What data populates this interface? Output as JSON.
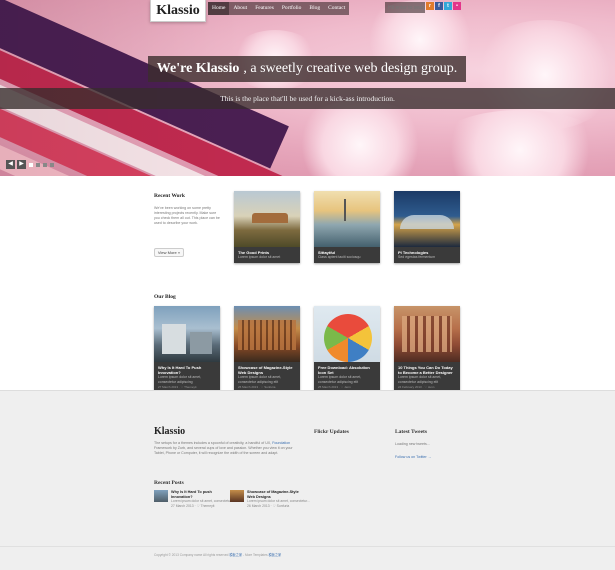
{
  "logo": "Klassio",
  "nav": [
    "Home",
    "About",
    "Features",
    "Portfolio",
    "Blog",
    "Contact"
  ],
  "search": {
    "placeholder": "Hit enter to search"
  },
  "social": [
    "rss-icon",
    "facebook-icon",
    "twitter-icon",
    "flickr-icon"
  ],
  "hero": {
    "headline_bold": "We're Klassio",
    "headline_rest": ", a sweetly creative web design group.",
    "subline": "This is the place that'll be used for a kick-ass introduction."
  },
  "recent_work": {
    "title": "Recent Work",
    "intro": "We've been working on some pretty interesting projects recently. Make sure you check them all out. This place can be used to describe your work.",
    "more_button": "View More »",
    "items": [
      {
        "title": "The Good Prints",
        "desc": "Lorem ipsum dolor sit amet"
      },
      {
        "title": "Sittaytful",
        "desc": "Class aptent taciti sociosqu"
      },
      {
        "title": "PI Technologies",
        "desc": "Sed egestas fermentum"
      }
    ]
  },
  "blog": {
    "title": "Our Blog",
    "posts": [
      {
        "title": "Why Is It Hard To Push Innovation?",
        "desc": "Lorem ipsum dolor sit amet, consectetur adipiscing",
        "meta": "27 March 2013  ·  ♡ Themeyit"
      },
      {
        "title": "Showcase of Magazine-Style Web Designs",
        "desc": "Lorem ipsum dolor sit amet, consectetur adipiscing elit",
        "meta": "26 March 2013  ·  ♡ Sunfuria"
      },
      {
        "title": "Free Download: Absolution Icon Set",
        "desc": "Lorem ipsum dolor sit amet, consectetur adipiscing elit",
        "meta": "25 March 2013  ·  ♡ Jenn"
      },
      {
        "title": "10 Things You Can Do Today to Become a Better Designer",
        "desc": "Lorem ipsum dolor sit amet, consectetur adipiscing elit",
        "meta": "24 February 2013  ·  ♡ Jenn"
      }
    ]
  },
  "footer": {
    "logo": "Klassio",
    "text_pre": "The setups for a themes includes a spoonful of creativity, a handful of UX,",
    "text_link": "Foundation",
    "text_post": "Framework by Zurb, and several cups of love and passion. Whether you view it on your Tablet, Phone or Computer, it will recognize the width of the screen and adapt.",
    "recent_posts_title": "Recent Posts",
    "recent_posts": [
      {
        "title": "Why Is It Hard To push Innovation?",
        "desc": "Lorem ipsum dolor sit amet, consectetur...",
        "meta": "27 March 2013  ·  ♡ Themeyit"
      },
      {
        "title": "Showcase of Magazine-Style Web Designs",
        "desc": "Lorem ipsum dolor sit amet, consectetur...",
        "meta": "26 March 2013  ·  ♡ Sunfuria"
      }
    ],
    "flickr_title": "Flickr Updates",
    "tweets_title": "Latest Tweets",
    "tweets_loading": "Loading new tweets...",
    "follow": "Follow us on Twitter →",
    "copyright_pre": "Copyright © 2013 Company name All rights reserved",
    "copyright_link1": "模板之家",
    "copyright_mid": " - More Templates ",
    "copyright_link2": "模板之家"
  },
  "watermark": "WWW.DOWNDEMO.COM",
  "colors": {
    "accent": "#3a6fb0",
    "caption_bg": "#3a3a3a",
    "hero_pink": "#f0bccd"
  }
}
